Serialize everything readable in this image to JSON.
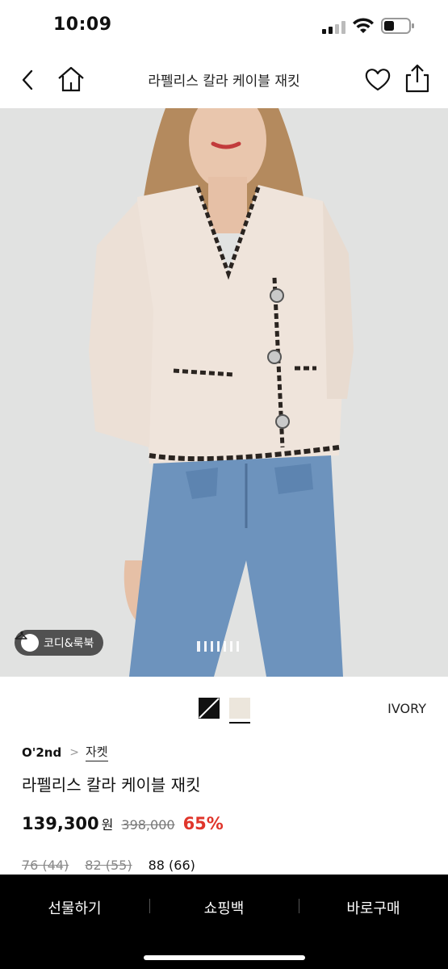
{
  "status_bar": {
    "time": "10:09",
    "icons": [
      "signal-icon",
      "wifi-icon",
      "battery-icon"
    ]
  },
  "nav": {
    "title": "라펠리스 칼라 케이블 재킷",
    "icons": [
      "back-arrow-icon",
      "home-icon",
      "heart-icon",
      "share-icon"
    ]
  },
  "hero": {
    "codi_label": "코디&룩북",
    "codi_icon": "hanger-icon",
    "page_count": 7,
    "active_page": 1
  },
  "colors": {
    "options": [
      "black-white",
      "ivory"
    ],
    "selected_name": "IVORY",
    "ivory_hex": "#ece6dc"
  },
  "product": {
    "brand": "O'2nd",
    "category": "자켓",
    "name": "라펠리스 칼라 케이블 재킷",
    "price": "139,300",
    "currency": "원",
    "original_price": "398,000",
    "discount": "65%",
    "discount_color": "#e0352b"
  },
  "sizes": [
    {
      "label": "76 (44)",
      "available": false
    },
    {
      "label": "82 (55)",
      "available": false
    },
    {
      "label": "88 (66)",
      "available": true
    }
  ],
  "bottom_bar": {
    "gift": "선물하기",
    "cart": "쇼핑백",
    "buy": "바로구매"
  }
}
